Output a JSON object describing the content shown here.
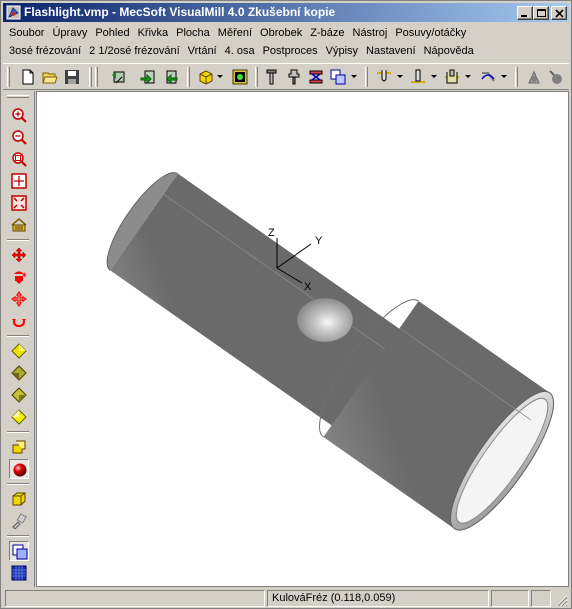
{
  "window": {
    "title": "Flashlight.vmp - MecSoft  VisualMill 4.0 Zkušební kopie",
    "app_icon": "visualmill-app-icon",
    "controls": [
      "minimize-icon",
      "maximize-icon",
      "close-icon"
    ]
  },
  "menu": {
    "row1": [
      "Soubor",
      "Úpravy",
      "Pohled",
      "Křivka",
      "Plocha",
      "Měření",
      "Obrobek",
      "Z-báze",
      "Nástroj",
      "Posuvy/otáčky"
    ],
    "row2": [
      "3osé frézování",
      "2 1/2osé frézování",
      "Vrtání",
      "4. osa",
      "Postproces",
      "Výpisy",
      "Nastavení",
      "Nápověda"
    ]
  },
  "toolbar_top": {
    "icons": [
      "new-file-icon",
      "open-folder-icon",
      "save-icon",
      "regenerate-icon",
      "import-icon",
      "export-icon",
      "stock-box-icon",
      "render-image-icon",
      "tool-icon",
      "tool-holder-icon",
      "machine-setup-icon",
      "view-copy-icon",
      "ball-mill-icon",
      "flat-mill-icon",
      "corner-radius-mill-icon",
      "feeds-icon",
      "simulate-icon",
      "cut-material-icon"
    ]
  },
  "toolbar_left": {
    "icons": [
      "zoom-in-icon",
      "zoom-out-icon",
      "zoom-box-icon",
      "zoom-fit-icon",
      "zoom-extents-icon",
      "zoom-previous-icon",
      "pan-icon",
      "dynamic-rotate-icon",
      "move-icon",
      "spin-icon",
      "view-top-icon",
      "view-front-icon",
      "view-right-icon",
      "view-iso-icon",
      "shaded-icon",
      "sphere-render-icon",
      "wireframe-box-icon",
      "toolpath-icon",
      "window-tile-icon",
      "grid-icon"
    ]
  },
  "viewport": {
    "axes": {
      "x": "X",
      "y": "Y",
      "z": "Z"
    },
    "model_color": "#a8a8a8"
  },
  "status": {
    "tool": "KulováFréz (0.118,0.059)"
  },
  "colors": {
    "titlebar_start": "#0a246a",
    "titlebar_end": "#a6caf0",
    "face": "#d4d0c8",
    "accent_red": "#ff0000",
    "accent_yellow": "#f0d800"
  }
}
